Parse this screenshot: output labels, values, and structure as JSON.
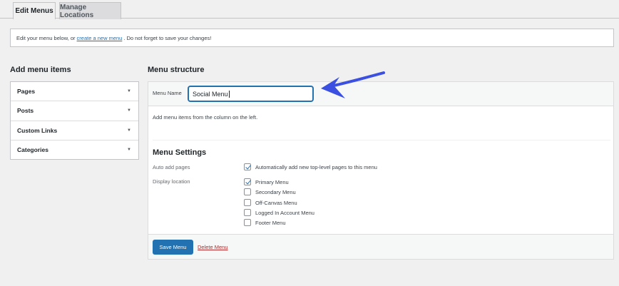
{
  "tabs": [
    {
      "label": "Edit Menus"
    },
    {
      "label": "Manage Locations"
    }
  ],
  "notice": {
    "prefix": "Edit your menu below, or",
    "link": "create a new menu",
    "suffix": ". Do not forget to save your changes!"
  },
  "add_items": {
    "title": "Add menu items",
    "sections": [
      {
        "label": "Pages"
      },
      {
        "label": "Posts"
      },
      {
        "label": "Custom Links"
      },
      {
        "label": "Categories"
      }
    ]
  },
  "structure": {
    "title": "Menu structure",
    "name_label": "Menu Name",
    "name_value": "Social Menu",
    "hint": "Add menu items from the column on the left."
  },
  "settings": {
    "title": "Menu Settings",
    "auto_add_label": "Auto add pages",
    "auto_add_option": {
      "label": "Automatically add new top-level pages to this menu",
      "checked": true
    },
    "display_label": "Display location",
    "locations": [
      {
        "label": "Primary Menu",
        "checked": true
      },
      {
        "label": "Secondary Menu",
        "checked": false
      },
      {
        "label": "Off-Canvas Menu",
        "checked": false
      },
      {
        "label": "Logged In Account Menu",
        "checked": false
      },
      {
        "label": "Footer Menu",
        "checked": false
      }
    ]
  },
  "footer": {
    "save_label": "Save Menu",
    "delete_label": "Delete Menu"
  },
  "colors": {
    "accent": "#2271b1",
    "danger": "#b32d2e",
    "annotation_arrow": "#3b4fe0"
  },
  "icons": {
    "section_toggle": "triangle-down-icon",
    "checkbox_check": "check-icon",
    "annotation": "pointer-arrow-icon"
  }
}
